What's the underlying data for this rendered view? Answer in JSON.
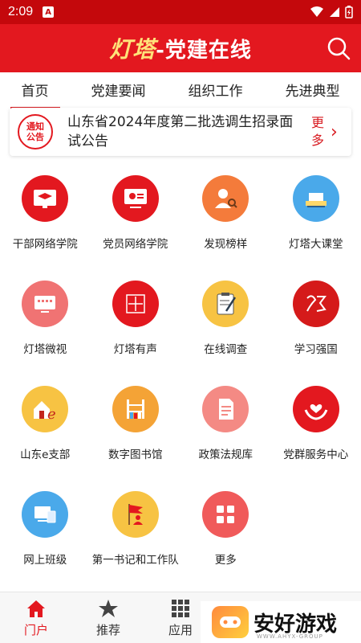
{
  "status_bar": {
    "time": "2:09",
    "notif": "A"
  },
  "header": {
    "logo_main": "灯塔",
    "logo_sub": "-党建在线"
  },
  "tabs": [
    {
      "label": "首页",
      "active": true
    },
    {
      "label": "党建要闻",
      "active": false
    },
    {
      "label": "组织工作",
      "active": false
    },
    {
      "label": "先进典型",
      "active": false
    }
  ],
  "notice": {
    "badge_line1": "通知",
    "badge_line2": "公告",
    "text": "山东省2024年度第二批选调生招录面试公告",
    "more": "更多"
  },
  "grid": [
    {
      "label": "干部网络学院",
      "icon": "graduation-cap-icon",
      "color": "#e3181f"
    },
    {
      "label": "党员网络学院",
      "icon": "party-screen-icon",
      "color": "#e3181f"
    },
    {
      "label": "发现榜样",
      "icon": "person-search-icon",
      "color": "#f47b3b"
    },
    {
      "label": "灯塔大课堂",
      "icon": "lecture-podium-icon",
      "color": "#4aa9ea"
    },
    {
      "label": "灯塔微视",
      "icon": "video-screen-icon",
      "color": "#f07373"
    },
    {
      "label": "灯塔有声",
      "icon": "audio-seal-icon",
      "color": "#e3181f"
    },
    {
      "label": "在线调查",
      "icon": "clipboard-pen-icon",
      "color": "#f7c343"
    },
    {
      "label": "学习强国",
      "icon": "study-seal-icon",
      "color": "#d51a1a"
    },
    {
      "label": "山东e支部",
      "icon": "home-e-icon",
      "color": "#f7c343"
    },
    {
      "label": "数字图书馆",
      "icon": "bookshelf-icon",
      "color": "#f4a336"
    },
    {
      "label": "政策法规库",
      "icon": "document-icon",
      "color": "#f48a84"
    },
    {
      "label": "党群服务中心",
      "icon": "heart-hands-icon",
      "color": "#e3181f"
    },
    {
      "label": "网上班级",
      "icon": "computer-class-icon",
      "color": "#4aa9ea"
    },
    {
      "label": "第一书记和工作队",
      "icon": "flag-person-icon",
      "color": "#f7c343"
    },
    {
      "label": "更多",
      "icon": "more-grid-icon",
      "color": "#f05a5a"
    }
  ],
  "bottom_nav": [
    {
      "label": "门户",
      "icon": "home-icon",
      "active": true
    },
    {
      "label": "推荐",
      "icon": "star-icon",
      "active": false
    },
    {
      "label": "应用",
      "icon": "apps-grid-icon",
      "active": false
    }
  ],
  "watermark": {
    "text": "安好游戏",
    "url": "WWW.AHYX-GROUP"
  }
}
